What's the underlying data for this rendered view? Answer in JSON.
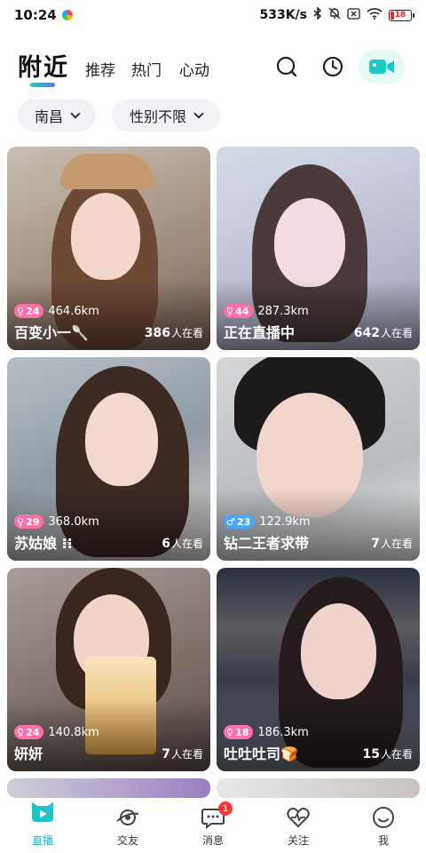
{
  "status_bar": {
    "time": "10:24",
    "network_speed": "533K/s",
    "battery": "18"
  },
  "header": {
    "tabs": [
      {
        "label": "附近",
        "active": true
      },
      {
        "label": "推荐",
        "active": false
      },
      {
        "label": "热门",
        "active": false
      },
      {
        "label": "心动",
        "active": false
      }
    ],
    "icons": [
      "search-icon",
      "history-clock-icon",
      "video-camera-icon"
    ]
  },
  "filters": {
    "city": "南昌",
    "gender": "性别不限"
  },
  "cards": [
    {
      "age": "24",
      "gender": "female",
      "distance": "464.6km",
      "name": "百变小一🥄",
      "viewers_count": "386",
      "viewers_suffix": "人在看"
    },
    {
      "age": "44",
      "gender": "female",
      "distance": "287.3km",
      "name": "正在直播中",
      "viewers_count": "642",
      "viewers_suffix": "人在看"
    },
    {
      "age": "29",
      "gender": "female",
      "distance": "368.0km",
      "name": "苏姑娘 ⁝⁝",
      "viewers_count": "6",
      "viewers_suffix": "人在看"
    },
    {
      "age": "23",
      "gender": "male",
      "distance": "122.9km",
      "name": "钻二王者求带",
      "viewers_count": "7",
      "viewers_suffix": "人在看"
    },
    {
      "age": "24",
      "gender": "female",
      "distance": "140.8km",
      "name": "妍妍",
      "viewers_count": "7",
      "viewers_suffix": "人在看"
    },
    {
      "age": "18",
      "gender": "female",
      "distance": "186.3km",
      "name": "吐吐吐司🍞",
      "viewers_count": "15",
      "viewers_suffix": "人在看"
    }
  ],
  "bottom_nav": [
    {
      "label": "直播",
      "icon": "live-tv-icon",
      "active": true
    },
    {
      "label": "交友",
      "icon": "eye-planet-icon",
      "active": false
    },
    {
      "label": "消息",
      "icon": "chat-bubble-icon",
      "active": false,
      "badge": "1"
    },
    {
      "label": "关注",
      "icon": "heartbeat-icon",
      "active": false
    },
    {
      "label": "我",
      "icon": "smiley-face-icon",
      "active": false
    }
  ],
  "colors": {
    "accent": "#19b8c0",
    "female_badge": "#ff6fa8",
    "male_badge": "#4aa6ff",
    "notification": "#ff3333"
  }
}
